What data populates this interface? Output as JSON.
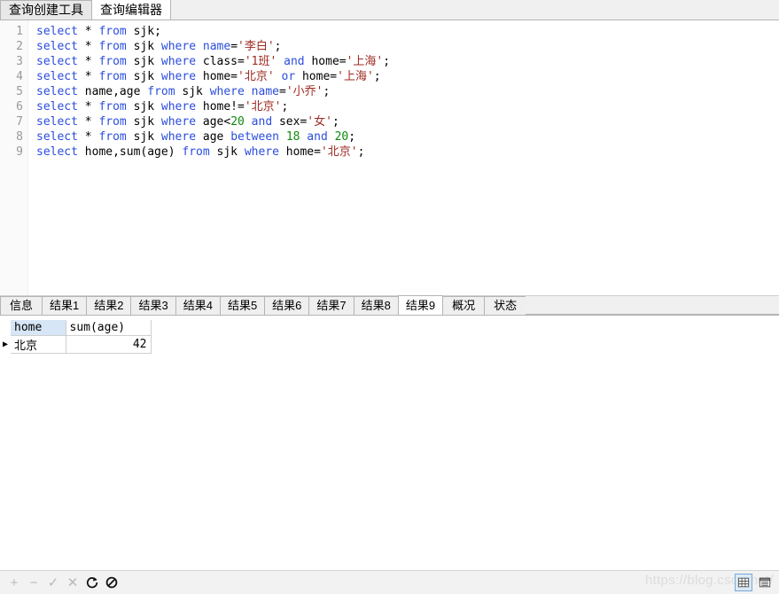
{
  "window": {
    "top_tabs": [
      {
        "label": "查询创建工具",
        "active": false
      },
      {
        "label": "查询编辑器",
        "active": true
      }
    ]
  },
  "editor": {
    "line_numbers": [
      "1",
      "2",
      "3",
      "4",
      "5",
      "6",
      "7",
      "8",
      "9"
    ],
    "lines": [
      [
        {
          "t": "select",
          "c": "kw"
        },
        {
          "t": " ",
          "c": "pln"
        },
        {
          "t": "*",
          "c": "pln"
        },
        {
          "t": " ",
          "c": "pln"
        },
        {
          "t": "from",
          "c": "kw"
        },
        {
          "t": " sjk;",
          "c": "pln"
        }
      ],
      [
        {
          "t": "select",
          "c": "kw"
        },
        {
          "t": " ",
          "c": "pln"
        },
        {
          "t": "*",
          "c": "pln"
        },
        {
          "t": " ",
          "c": "pln"
        },
        {
          "t": "from",
          "c": "kw"
        },
        {
          "t": " sjk ",
          "c": "pln"
        },
        {
          "t": "where",
          "c": "kw"
        },
        {
          "t": " ",
          "c": "pln"
        },
        {
          "t": "name",
          "c": "kw"
        },
        {
          "t": "=",
          "c": "pln"
        },
        {
          "t": "'李白'",
          "c": "str"
        },
        {
          "t": ";",
          "c": "pln"
        }
      ],
      [
        {
          "t": "select",
          "c": "kw"
        },
        {
          "t": " ",
          "c": "pln"
        },
        {
          "t": "*",
          "c": "pln"
        },
        {
          "t": " ",
          "c": "pln"
        },
        {
          "t": "from",
          "c": "kw"
        },
        {
          "t": " sjk ",
          "c": "pln"
        },
        {
          "t": "where",
          "c": "kw"
        },
        {
          "t": " class=",
          "c": "pln"
        },
        {
          "t": "'1班'",
          "c": "str"
        },
        {
          "t": " ",
          "c": "pln"
        },
        {
          "t": "and",
          "c": "kw"
        },
        {
          "t": " home=",
          "c": "pln"
        },
        {
          "t": "'上海'",
          "c": "str"
        },
        {
          "t": ";",
          "c": "pln"
        }
      ],
      [
        {
          "t": "select",
          "c": "kw"
        },
        {
          "t": " ",
          "c": "pln"
        },
        {
          "t": "*",
          "c": "pln"
        },
        {
          "t": " ",
          "c": "pln"
        },
        {
          "t": "from",
          "c": "kw"
        },
        {
          "t": " sjk ",
          "c": "pln"
        },
        {
          "t": "where",
          "c": "kw"
        },
        {
          "t": " home=",
          "c": "pln"
        },
        {
          "t": "'北京'",
          "c": "str"
        },
        {
          "t": " ",
          "c": "pln"
        },
        {
          "t": "or",
          "c": "kw"
        },
        {
          "t": " home=",
          "c": "pln"
        },
        {
          "t": "'上海'",
          "c": "str"
        },
        {
          "t": ";",
          "c": "pln"
        }
      ],
      [
        {
          "t": "select",
          "c": "kw"
        },
        {
          "t": " name,age ",
          "c": "pln"
        },
        {
          "t": "from",
          "c": "kw"
        },
        {
          "t": " sjk ",
          "c": "pln"
        },
        {
          "t": "where",
          "c": "kw"
        },
        {
          "t": " ",
          "c": "pln"
        },
        {
          "t": "name",
          "c": "kw"
        },
        {
          "t": "=",
          "c": "pln"
        },
        {
          "t": "'小乔'",
          "c": "str"
        },
        {
          "t": ";",
          "c": "pln"
        }
      ],
      [
        {
          "t": "select",
          "c": "kw"
        },
        {
          "t": " ",
          "c": "pln"
        },
        {
          "t": "*",
          "c": "pln"
        },
        {
          "t": " ",
          "c": "pln"
        },
        {
          "t": "from",
          "c": "kw"
        },
        {
          "t": " sjk ",
          "c": "pln"
        },
        {
          "t": "where",
          "c": "kw"
        },
        {
          "t": " home!=",
          "c": "pln"
        },
        {
          "t": "'北京'",
          "c": "str"
        },
        {
          "t": ";",
          "c": "pln"
        }
      ],
      [
        {
          "t": "select",
          "c": "kw"
        },
        {
          "t": " ",
          "c": "pln"
        },
        {
          "t": "*",
          "c": "pln"
        },
        {
          "t": " ",
          "c": "pln"
        },
        {
          "t": "from",
          "c": "kw"
        },
        {
          "t": " sjk ",
          "c": "pln"
        },
        {
          "t": "where",
          "c": "kw"
        },
        {
          "t": " age<",
          "c": "pln"
        },
        {
          "t": "20",
          "c": "num"
        },
        {
          "t": " ",
          "c": "pln"
        },
        {
          "t": "and",
          "c": "kw"
        },
        {
          "t": " sex=",
          "c": "pln"
        },
        {
          "t": "'女'",
          "c": "str"
        },
        {
          "t": ";",
          "c": "pln"
        }
      ],
      [
        {
          "t": "select",
          "c": "kw"
        },
        {
          "t": " ",
          "c": "pln"
        },
        {
          "t": "*",
          "c": "pln"
        },
        {
          "t": " ",
          "c": "pln"
        },
        {
          "t": "from",
          "c": "kw"
        },
        {
          "t": " sjk ",
          "c": "pln"
        },
        {
          "t": "where",
          "c": "kw"
        },
        {
          "t": " age ",
          "c": "pln"
        },
        {
          "t": "between",
          "c": "kw"
        },
        {
          "t": " ",
          "c": "pln"
        },
        {
          "t": "18",
          "c": "num"
        },
        {
          "t": " ",
          "c": "pln"
        },
        {
          "t": "and",
          "c": "kw"
        },
        {
          "t": " ",
          "c": "pln"
        },
        {
          "t": "20",
          "c": "num"
        },
        {
          "t": ";",
          "c": "pln"
        }
      ],
      [
        {
          "t": "select",
          "c": "kw"
        },
        {
          "t": " home,sum(age) ",
          "c": "pln"
        },
        {
          "t": "from",
          "c": "kw"
        },
        {
          "t": " sjk ",
          "c": "pln"
        },
        {
          "t": "where",
          "c": "kw"
        },
        {
          "t": " home=",
          "c": "pln"
        },
        {
          "t": "'北京'",
          "c": "str"
        },
        {
          "t": ";",
          "c": "pln"
        }
      ]
    ]
  },
  "result_tabs": [
    {
      "label": "信息",
      "active": false
    },
    {
      "label": "结果1",
      "active": false
    },
    {
      "label": "结果2",
      "active": false
    },
    {
      "label": "结果3",
      "active": false
    },
    {
      "label": "结果4",
      "active": false
    },
    {
      "label": "结果5",
      "active": false
    },
    {
      "label": "结果6",
      "active": false
    },
    {
      "label": "结果7",
      "active": false
    },
    {
      "label": "结果8",
      "active": false
    },
    {
      "label": "结果9",
      "active": true
    },
    {
      "label": "概况",
      "active": false
    },
    {
      "label": "状态",
      "active": false
    }
  ],
  "result_grid": {
    "columns": [
      "home",
      "sum(age)"
    ],
    "selected_column": "home",
    "row_marker": "▶",
    "rows": [
      {
        "home": "北京",
        "sum_age": "42"
      }
    ]
  },
  "bottom_toolbar": {
    "buttons": [
      {
        "name": "add-record-button",
        "glyph": "+",
        "enabled": false
      },
      {
        "name": "delete-record-button",
        "glyph": "−",
        "enabled": false
      },
      {
        "name": "confirm-record-button",
        "glyph": "✓",
        "enabled": false
      },
      {
        "name": "cancel-record-button",
        "glyph": "✕",
        "enabled": false
      },
      {
        "name": "refresh-button",
        "glyph": "⟳",
        "enabled": true
      },
      {
        "name": "stop-button",
        "glyph": "🚫",
        "enabled": true
      }
    ],
    "watermark": "https://blog.csdn.net/",
    "view_modes": [
      {
        "name": "grid-view-button",
        "selected": true
      },
      {
        "name": "form-view-button",
        "selected": false
      }
    ]
  },
  "colors": {
    "keyword": "#2b4ddc",
    "string": "#9e2b22",
    "number": "#0e8a0e",
    "plain": "#000000",
    "selected_header": "#d7e6f7",
    "tab_bar": "#f0f0f0",
    "accent": "#7aa8d8"
  }
}
